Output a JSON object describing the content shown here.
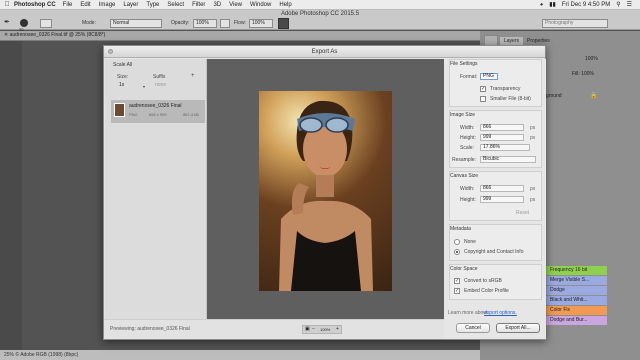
{
  "menubar": {
    "app_name": "Photoshop CC",
    "items": [
      "File",
      "Edit",
      "Image",
      "Layer",
      "Type",
      "Select",
      "Filter",
      "3D",
      "View",
      "Window",
      "Help"
    ],
    "clock": "Fri Dec 9  4:50 PM"
  },
  "optionsbar": {
    "app_title": "Adobe Photoshop CC 2015.5",
    "brush_size": "30",
    "mode_label": "Mode:",
    "mode_value": "Normal",
    "opacity_label": "Opacity:",
    "opacity_value": "100%",
    "flow_label": "Flow:",
    "flow_value": "100%",
    "workspace": "Photography"
  },
  "document": {
    "tab_title": "audrenosee_0326 Final.tif @ 25% (8C8/8*)",
    "status": "25%    © Adobe RGB (1998) (8bpc)"
  },
  "panels": {
    "tabs": [
      "Layers",
      "Properties"
    ],
    "partial_labels": [
      "100%",
      "Fill: 100%",
      "ground"
    ],
    "adjustment_layers": [
      {
        "label": "Frequency 16 bit",
        "color": "#8fd14f"
      },
      {
        "label": "Merge Visible S...",
        "color": "#9aa9e0"
      },
      {
        "label": "Dodge",
        "color": "#9aa9e0"
      },
      {
        "label": "Black and Whit...",
        "color": "#9aa9e0"
      },
      {
        "label": "Color Fix",
        "color": "#f29a52"
      },
      {
        "label": "Dodge and Bur...",
        "color": "#c9a6e0"
      }
    ]
  },
  "dialog": {
    "title": "Export As",
    "scale_all": {
      "header": "Scale All",
      "size_label": "Size:",
      "suffix_label": "Suffix",
      "add_symbol": "+",
      "size_value": "1x",
      "suffix_value": "none"
    },
    "asset": {
      "name": "audrenosee_0326 Final",
      "format": "PNG",
      "dimensions": "866 x 999",
      "filesize": "867.4 kB"
    },
    "file_settings": {
      "header": "File Settings",
      "format_label": "Format:",
      "format_value": "PNG",
      "transparency_label": "Transparency",
      "transparency_checked": true,
      "smaller_file_label": "Smaller File (8-bit)",
      "smaller_file_checked": false
    },
    "image_size": {
      "header": "Image Size",
      "width_label": "Width:",
      "width_value": "866",
      "height_label": "Height:",
      "height_value": "999",
      "unit": "px",
      "scale_label": "Scale:",
      "scale_value": "17.86%",
      "resample_label": "Resample:",
      "resample_value": "Bicubic"
    },
    "canvas_size": {
      "header": "Canvas Size",
      "width_label": "Width:",
      "width_value": "866",
      "height_label": "Height:",
      "height_value": "999",
      "unit": "px",
      "reset_label": "Reset"
    },
    "metadata": {
      "header": "Metadata",
      "options": [
        "None",
        "Copyright and Contact Info"
      ],
      "selected_index": 1
    },
    "color_space": {
      "header": "Color Space",
      "convert_label": "Convert to sRGB",
      "convert_checked": true,
      "embed_label": "Embed Color Profile",
      "embed_checked": true
    },
    "learn_more_text": "Learn more about",
    "learn_more_link": "export options.",
    "previewing_text": "Previewing: audrenosee_0326 Final",
    "zoom_value": "100%",
    "cancel_label": "Cancel",
    "export_label": "Export All..."
  }
}
